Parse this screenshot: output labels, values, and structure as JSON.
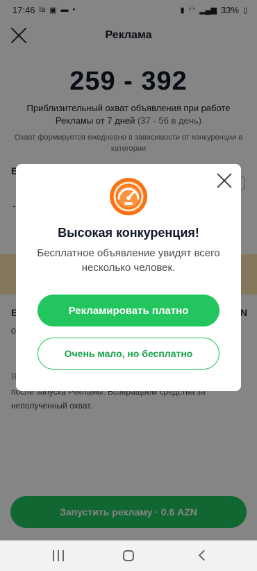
{
  "status_bar": {
    "time": "17:46",
    "battery": "33%",
    "icons": [
      "la-icon",
      "gallery-icon",
      "chat-icon",
      "dot-icon",
      "lock-icon",
      "wifi-icon",
      "signal-icon",
      "battery-icon"
    ]
  },
  "header": {
    "title": "Реклама",
    "close_icon": "close-icon"
  },
  "reach": {
    "range": "259 - 392",
    "desc_main": "Приблизительный охват объявления при работе Рекламы от 7 дней",
    "desc_per_day": "(37 - 56 в день)",
    "note": "Охват формируется ежедневно в зависимости от конкуренции в категории"
  },
  "background": {
    "frag_b": "Б",
    "frag_dash": "-",
    "frag_b2": "Б",
    "frag_n": "N",
    "frag_o": "0",
    "frag_b3": "В",
    "tail_text": "после запуска Рекламы. Возвращаем средства за неполученный охват."
  },
  "modal": {
    "icon": "speedometer-icon",
    "title": "Высокая конкуренция!",
    "text": "Бесплатное объявление увидят всего несколько человек.",
    "paid_button": "Рекламировать платно",
    "free_button": "Очень мало, но бесплатно",
    "close_icon": "close-icon"
  },
  "footer": {
    "launch_button": "Запустить рекламу · 0.6 AZN"
  },
  "colors": {
    "primary_green": "#22c55e",
    "gauge_orange": "#f97316",
    "dark_text": "#111827"
  },
  "navbar": {
    "recents_icon": "recents-icon",
    "home_icon": "home-icon",
    "back_icon": "back-icon"
  }
}
